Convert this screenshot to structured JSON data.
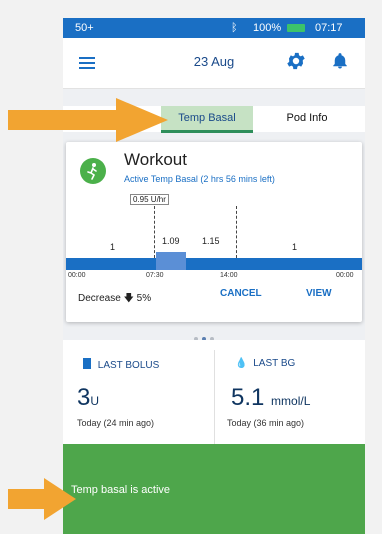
{
  "status_bar": {
    "glucose": "50+",
    "battery": "100%",
    "time": "07:17"
  },
  "header": {
    "date": "23 Aug"
  },
  "tabs": [
    {
      "label": "Temp Basal",
      "active": true
    },
    {
      "label": "Pod Info",
      "active": false
    }
  ],
  "card": {
    "title": "Workout",
    "subtitle": "Active Temp Basal (2 hrs 56 mins left)",
    "current_rate": "0.95 U/hr",
    "rate_labels": [
      "1",
      "1.09",
      "1.15",
      "1"
    ],
    "time_labels": [
      "00:00",
      "07:30",
      "14:00",
      "00:00"
    ],
    "decrease_label": "Decrease",
    "decrease_value": "5%",
    "cancel_label": "CANCEL",
    "view_label": "VIEW"
  },
  "pager": {
    "count": 3,
    "active_index": 1
  },
  "last_bolus": {
    "label": "LAST BOLUS",
    "value": "3",
    "unit": "U",
    "time": "Today (24 min ago)"
  },
  "last_bg": {
    "label": "LAST BG",
    "value": "5.1",
    "unit": "mmol/L",
    "time": "Today (36 min ago)"
  },
  "toast": {
    "message": "Temp basal is active"
  },
  "colors": {
    "primary": "#1a6fc4",
    "toast": "#4ea64b",
    "arrow": "#f2a431",
    "tab_active": "#c6e2c4"
  }
}
